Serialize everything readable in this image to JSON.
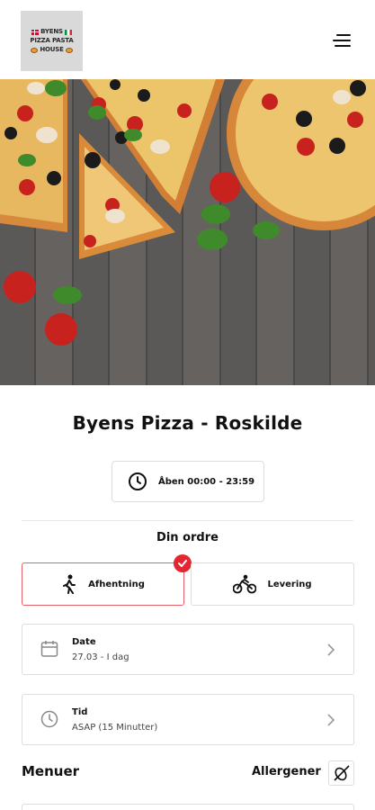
{
  "header": {
    "logo_lines": [
      "BYENS",
      "PIZZA PASTA",
      "HOUSE"
    ],
    "menu_icon": "hamburger-menu-icon"
  },
  "hero": {
    "image": "pizza-on-wooden-table"
  },
  "restaurant": {
    "name": "Byens Pizza - Roskilde"
  },
  "hours": {
    "icon": "clock-icon",
    "text": "Åben 00:00 - 23:59"
  },
  "order": {
    "title": "Din ordre",
    "options": [
      {
        "label": "Afhentning",
        "icon": "walking-person-icon",
        "selected": true
      },
      {
        "label": "Levering",
        "icon": "bicycle-courier-icon",
        "selected": false
      }
    ]
  },
  "date": {
    "label": "Date",
    "value": "27.03 - I dag",
    "icon": "calendar-icon"
  },
  "time": {
    "label": "Tid",
    "value": "ASAP (15 Minutter)",
    "icon": "clock-icon"
  },
  "sections": {
    "menus": "Menuer",
    "allergens": "Allergener"
  },
  "colors": {
    "accent": "#e3262f",
    "border": "#dddddd",
    "text": "#111111"
  }
}
